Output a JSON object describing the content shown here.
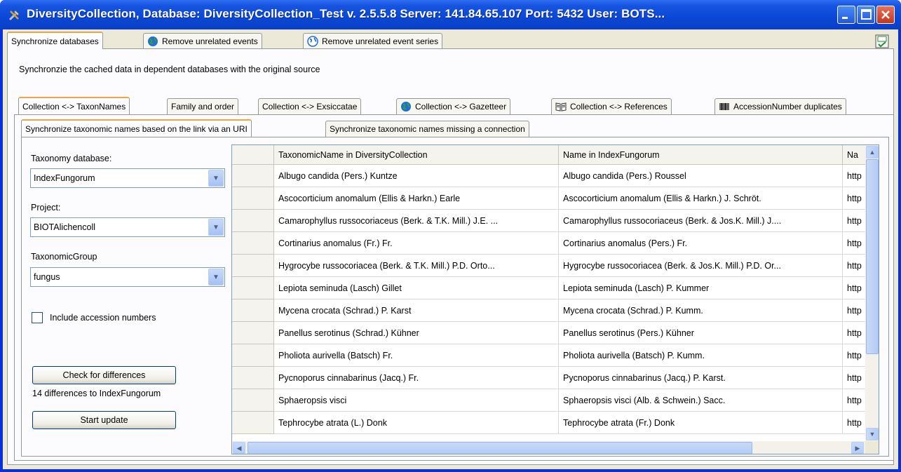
{
  "window": {
    "title": "DiversityCollection, Database: DiversityCollection_Test   v. 2.5.5.8   Server: 141.84.65.107   Port: 5432   User: BOTS..."
  },
  "top_tabs": [
    {
      "label": "Synchronize databases",
      "icon": ""
    },
    {
      "label": "Remove unrelated events",
      "icon": "globe-icon"
    },
    {
      "label": "Remove unrelated event series",
      "icon": "globe-icon"
    }
  ],
  "description": "Synchronzie the cached data in dependent databases with the original source",
  "sync_tabs": [
    {
      "label": "Collection <-> TaxonNames",
      "icon": ""
    },
    {
      "label": "Family and order",
      "icon": ""
    },
    {
      "label": "Collection <-> Exsiccatae",
      "icon": ""
    },
    {
      "label": "Collection <-> Gazetteer",
      "icon": "globe-icon"
    },
    {
      "label": "Collection <-> References",
      "icon": "book-icon"
    },
    {
      "label": "AccessionNumber duplicates",
      "icon": "barcode-icon"
    }
  ],
  "sub_tabs": [
    {
      "label": "Synchronize taxonomic names based on the link via an URI"
    },
    {
      "label": "Synchronize taxonomic names missing a connection"
    }
  ],
  "form": {
    "taxonomy_db_label": "Taxonomy database:",
    "taxonomy_db_value": "IndexFungorum",
    "project_label": "Project:",
    "project_value": "BIOTAlichencoll",
    "group_label": "TaxonomicGroup",
    "group_value": "fungus",
    "include_accession_label": "Include accession numbers",
    "check_button": "Check for differences",
    "status_text": "14 differences to IndexFungorum",
    "update_button": "Start update"
  },
  "grid": {
    "columns": [
      "TaxonomicName in DiversityCollection",
      "Name in IndexFungorum",
      "Na"
    ],
    "rows": [
      [
        "Albugo candida (Pers.) Kuntze",
        "Albugo candida (Pers.) Roussel",
        "http"
      ],
      [
        "Ascocorticium anomalum (Ellis & Harkn.) Earle",
        "Ascocorticium anomalum (Ellis & Harkn.) J. Schröt.",
        "http"
      ],
      [
        "Camarophyllus russocoriaceus (Berk. & T.K. Mill.) J.E. ...",
        "Camarophyllus russocoriaceus (Berk. & Jos.K. Mill.) J....",
        "http"
      ],
      [
        "Cortinarius anomalus (Fr.) Fr.",
        "Cortinarius anomalus (Pers.) Fr.",
        "http"
      ],
      [
        "Hygrocybe russocoriacea (Berk. & T.K. Mill.) P.D. Orto...",
        "Hygrocybe russocoriacea (Berk. & Jos.K. Mill.) P.D. Or...",
        "http"
      ],
      [
        "Lepiota seminuda (Lasch) Gillet",
        "Lepiota seminuda (Lasch) P. Kummer",
        "http"
      ],
      [
        "Mycena crocata (Schrad.) P. Karst",
        "Mycena crocata (Schrad.) P. Kumm.",
        "http"
      ],
      [
        "Panellus serotinus (Schrad.) Kühner",
        "Panellus serotinus (Pers.) Kühner",
        "http"
      ],
      [
        "Pholiota aurivella (Batsch) Fr.",
        "Pholiota aurivella (Batsch) P. Kumm.",
        "http"
      ],
      [
        "Pycnoporus cinnabarinus (Jacq.) Fr.",
        "Pycnoporus cinnabarinus (Jacq.) P. Karst.",
        "http"
      ],
      [
        "Sphaeropsis visci",
        "Sphaeropsis visci (Alb. & Schwein.) Sacc.",
        "http"
      ],
      [
        "Tephrocybe atrata (L.) Donk",
        "Tephrocybe atrata (Fr.) Donk",
        "http"
      ]
    ]
  },
  "colors": {
    "title_bar": "#0a47d6",
    "window_bg": "#ece9d8",
    "tab_highlight": "#e8a848"
  }
}
